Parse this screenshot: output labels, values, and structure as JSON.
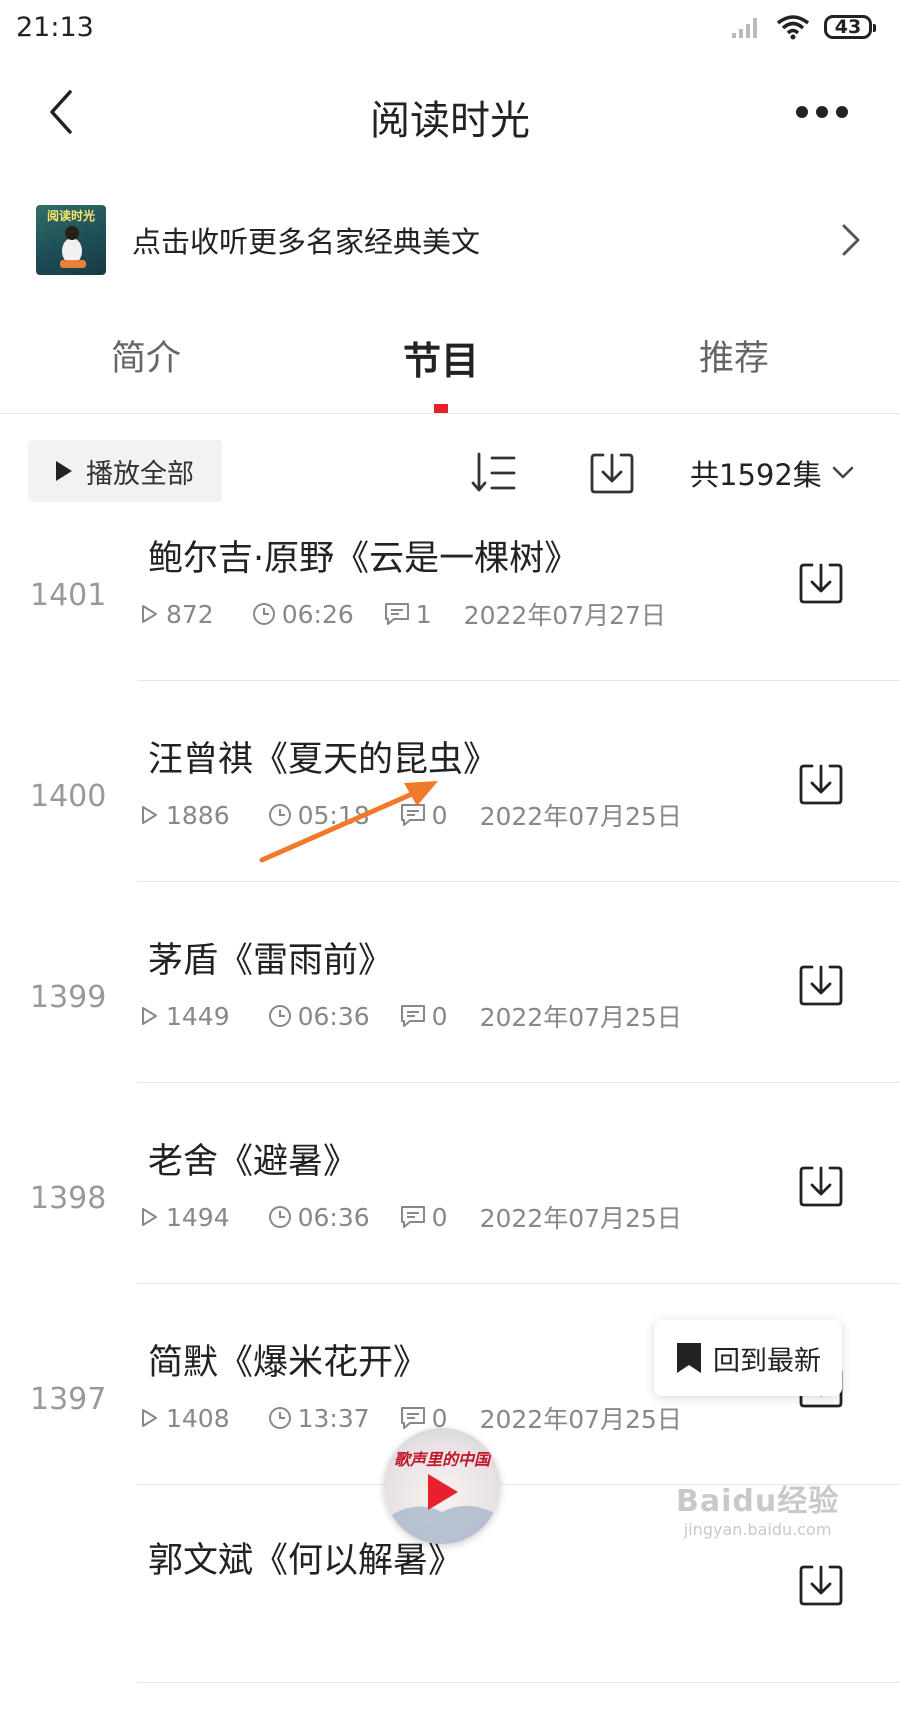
{
  "status_bar": {
    "time": "21:13",
    "battery": "43"
  },
  "header": {
    "title": "阅读时光"
  },
  "banner": {
    "cover_text": "阅读时光",
    "text": "点击收听更多名家经典美文"
  },
  "tabs": [
    {
      "label": "简介",
      "active": false
    },
    {
      "label": "节目",
      "active": true
    },
    {
      "label": "推荐",
      "active": false
    }
  ],
  "toolbar": {
    "play_all_label": "播放全部",
    "episode_count": "共1592集"
  },
  "episodes": [
    {
      "number": "1401",
      "title": "鲍尔吉·原野《云是一棵树》",
      "plays": "872",
      "duration": "06:26",
      "comments": "1",
      "date": "2022年07月27日"
    },
    {
      "number": "1400",
      "title": "汪曾祺《夏天的昆虫》",
      "plays": "1886",
      "duration": "05:18",
      "comments": "0",
      "date": "2022年07月25日"
    },
    {
      "number": "1399",
      "title": "茅盾《雷雨前》",
      "plays": "1449",
      "duration": "06:36",
      "comments": "0",
      "date": "2022年07月25日"
    },
    {
      "number": "1398",
      "title": "老舍《避暑》",
      "plays": "1494",
      "duration": "06:36",
      "comments": "0",
      "date": "2022年07月25日"
    },
    {
      "number": "1397",
      "title": "简默《爆米花开》",
      "plays": "1408",
      "duration": "13:37",
      "comments": "0",
      "date": "2022年07月25日"
    },
    {
      "number": "",
      "title": "郭文斌《何以解暑》",
      "plays": "",
      "duration": "",
      "comments": "",
      "date": ""
    }
  ],
  "floating": {
    "back_to_latest": "回到最新"
  },
  "mini_player": {
    "title": "歌声里的中国"
  },
  "watermark": {
    "main": "Baidu经验",
    "sub": "jingyan.baidu.com"
  },
  "colors": {
    "accent": "#e8202e",
    "annotation_arrow": "#f07a2a"
  }
}
